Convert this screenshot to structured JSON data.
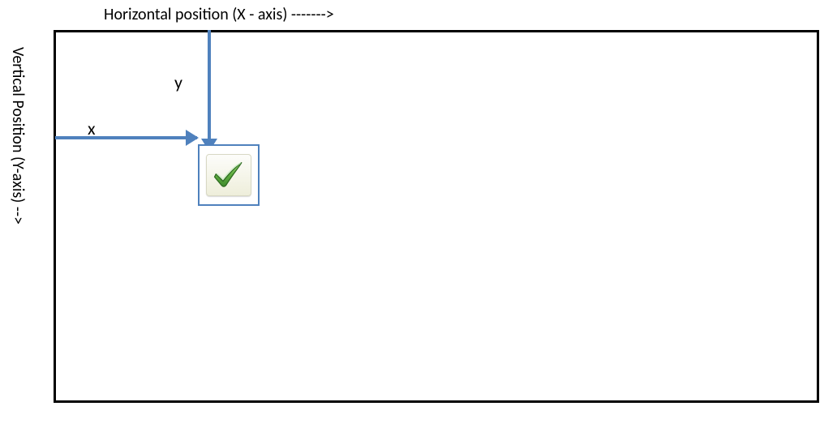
{
  "labels": {
    "x_axis_title": "Horizontal position (X - axis) ------->",
    "y_axis_title": "Vertical Position (Y-axis)   -->",
    "x_marker": "x",
    "y_marker": "y"
  },
  "icons": {
    "checkmark": "checkmark-icon"
  },
  "colors": {
    "arrow": "#4f81bd",
    "frame_border": "#000000",
    "check_green_dark": "#3f8a2e",
    "check_green_light": "#7fc24a"
  }
}
